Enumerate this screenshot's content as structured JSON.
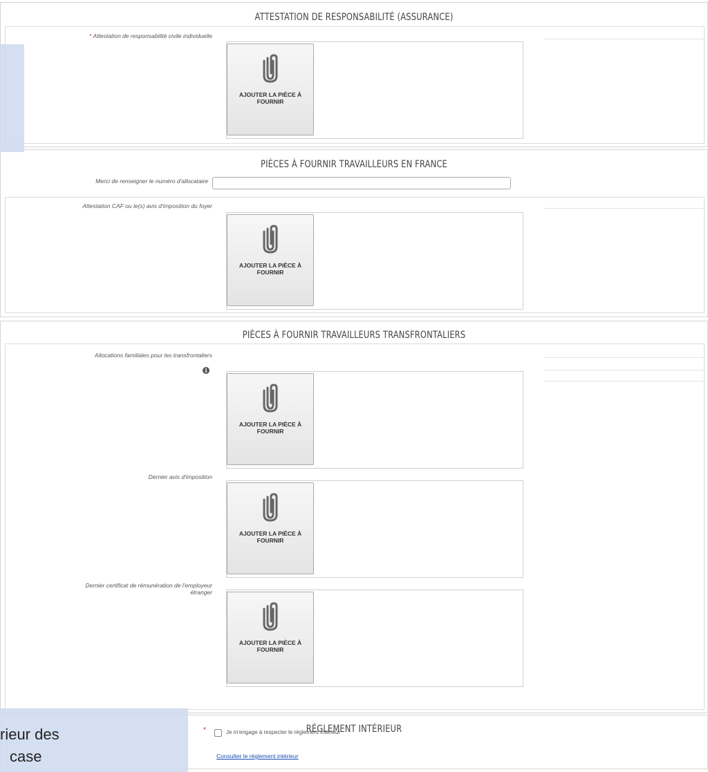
{
  "upload_label": "AJOUTER LA PIÈCE À FOURNIR",
  "icon": "paperclip-icon",
  "sections": {
    "assurance": {
      "title": "ATTESTATION DE RESPONSABILITÉ (ASSURANCE)",
      "field_label": "Attestation de responsabilité civile individuelle",
      "required_mark": "*"
    },
    "france": {
      "title": "PIÈCES À FOURNIR TRAVAILLEURS EN FRANCE",
      "allocataire_label": "Merci de renseigner le numéro d'allocataire",
      "allocataire_value": "",
      "caf_label": "Attestation CAF ou le(s) avis d'imposition du foyer"
    },
    "transfrontaliers": {
      "title": "PIÈCES À FOURNIR TRAVAILLEURS TRANSFRONTALIERS",
      "alloc_label": "Allocations familiales pour les transfrontaliers",
      "info_icon": "i",
      "avis_label": "Dernier avis d'imposition",
      "certificat_label": "Dernier certificat de rémunération de l'employeur étranger"
    },
    "reglement": {
      "title": "RÈGLEMENT INTÉRIEUR",
      "required_mark": "*",
      "checkbox_label": "Je m'engage à respecter le règlement intérieur",
      "link_text": "Consulter le règlement intérieur"
    }
  },
  "overlay": {
    "line1": "rieur des",
    "line2": "case"
  }
}
